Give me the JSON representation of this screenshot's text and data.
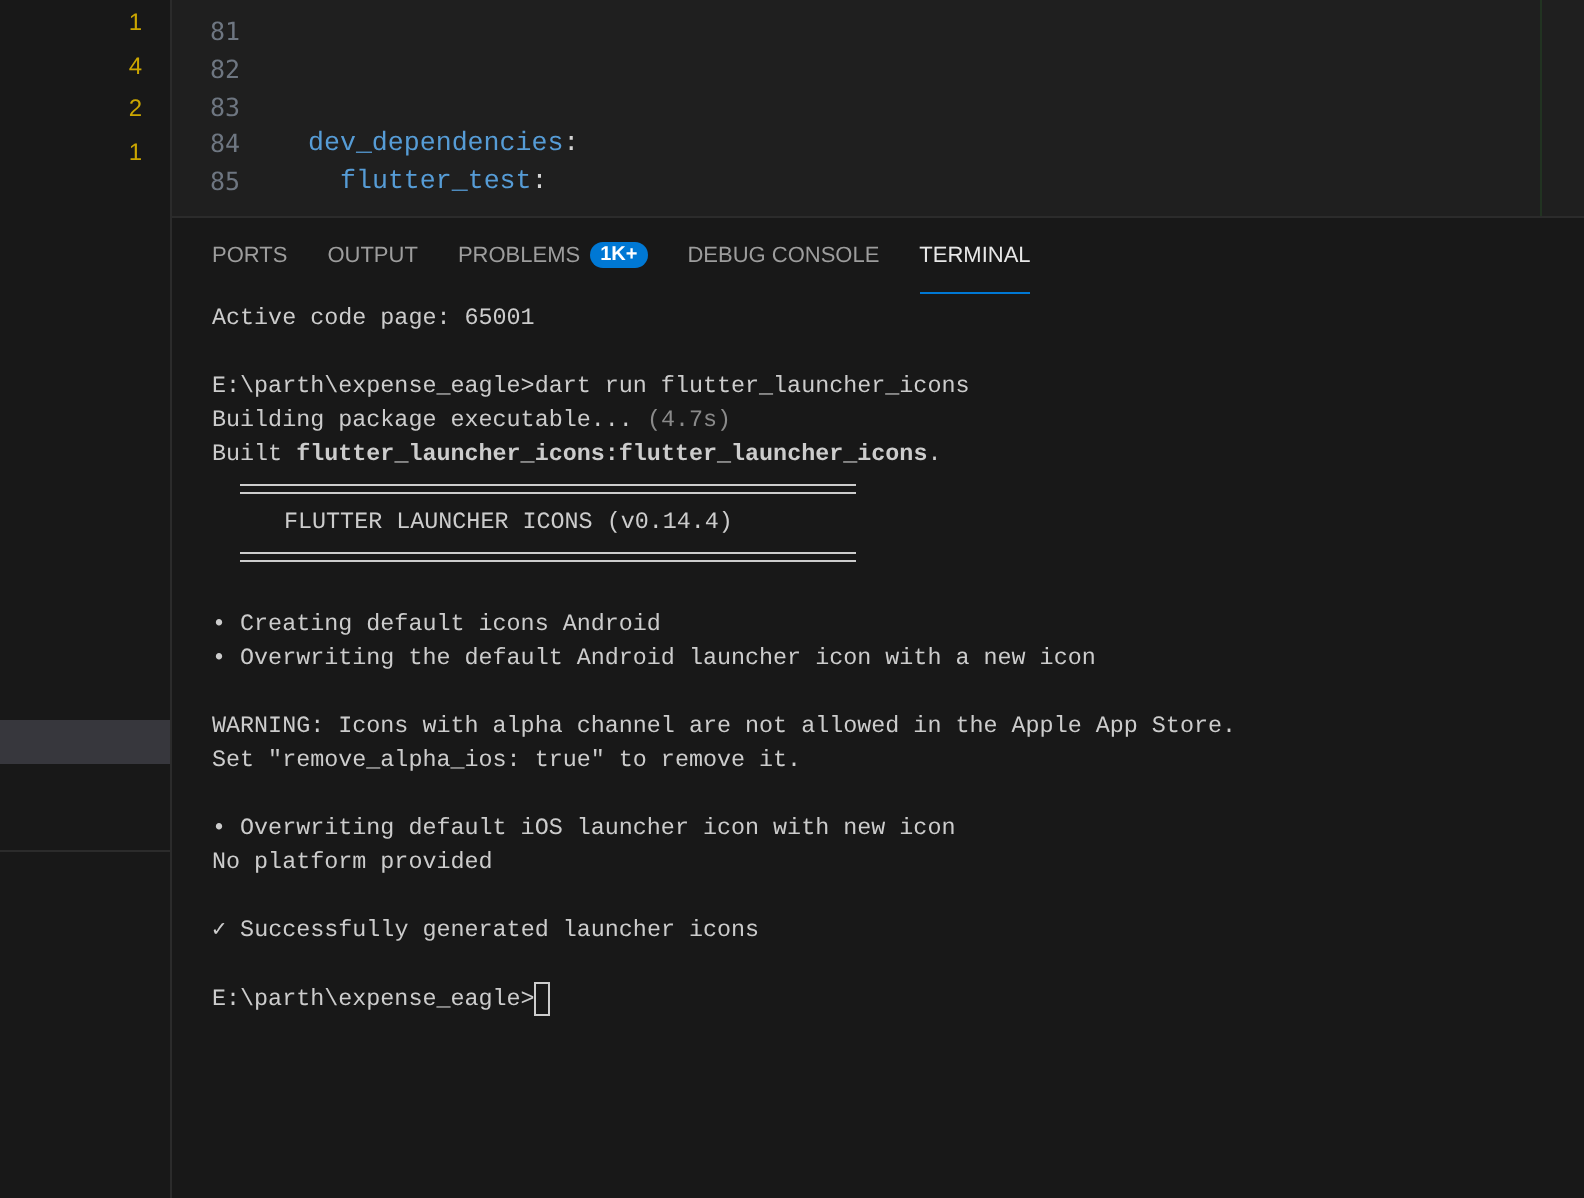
{
  "sidebar": {
    "badges": [
      "1",
      "4",
      "2",
      "1"
    ],
    "items": [
      {
        "selected": true
      }
    ]
  },
  "editor": {
    "lines": [
      {
        "number": "81"
      },
      {
        "number": "82"
      },
      {
        "number": "83"
      },
      {
        "number": "84",
        "tokens": [
          {
            "text": "dev_dependencies",
            "kind": "key"
          },
          {
            "text": ":",
            "kind": "punct"
          }
        ],
        "children": [
          {
            "number": "85",
            "tokens": [
              {
                "text": "flutter_test",
                "kind": "key"
              },
              {
                "text": ":",
                "kind": "punct"
              }
            ]
          }
        ]
      }
    ]
  },
  "panel": {
    "tabs": [
      {
        "label": "PORTS",
        "selected": false
      },
      {
        "label": "OUTPUT",
        "selected": false
      },
      {
        "label": "PROBLEMS",
        "selected": false,
        "badge": "1K+"
      },
      {
        "label": "DEBUG CONSOLE",
        "selected": false
      },
      {
        "label": "TERMINAL",
        "selected": true
      }
    ],
    "terminal": [
      {
        "kind": "text",
        "text": "Active code page: 65001"
      },
      {
        "kind": "blank"
      },
      {
        "kind": "text",
        "text": "E:\\parth\\expense_eagle>dart run flutter_launcher_icons"
      },
      {
        "kind": "text",
        "text": "Building package executable... ",
        "dim": "(4.7s)"
      },
      {
        "kind": "text",
        "text": "Built **flutter_launcher_icons:flutter_launcher_icons**."
      },
      {
        "kind": "rule"
      },
      {
        "kind": "banner",
        "text": "FLUTTER LAUNCHER ICONS (v0.14.4)"
      },
      {
        "kind": "rule"
      },
      {
        "kind": "blank"
      },
      {
        "kind": "text",
        "text": "• Creating default icons Android"
      },
      {
        "kind": "text",
        "text": "• Overwriting the default Android launcher icon with a new icon"
      },
      {
        "kind": "blank"
      },
      {
        "kind": "text",
        "text": "WARNING: Icons with alpha channel are not allowed in the Apple App Store."
      },
      {
        "kind": "text",
        "text": "Set \"remove_alpha_ios: true\" to remove it."
      },
      {
        "kind": "blank"
      },
      {
        "kind": "text",
        "text": "• Overwriting default iOS launcher icon with new icon"
      },
      {
        "kind": "text",
        "text": "No platform provided"
      },
      {
        "kind": "blank"
      },
      {
        "kind": "text",
        "text": "✓ Successfully generated launcher icons"
      },
      {
        "kind": "blank"
      },
      {
        "kind": "prompt",
        "text": "E:\\parth\\expense_eagle>"
      }
    ]
  }
}
